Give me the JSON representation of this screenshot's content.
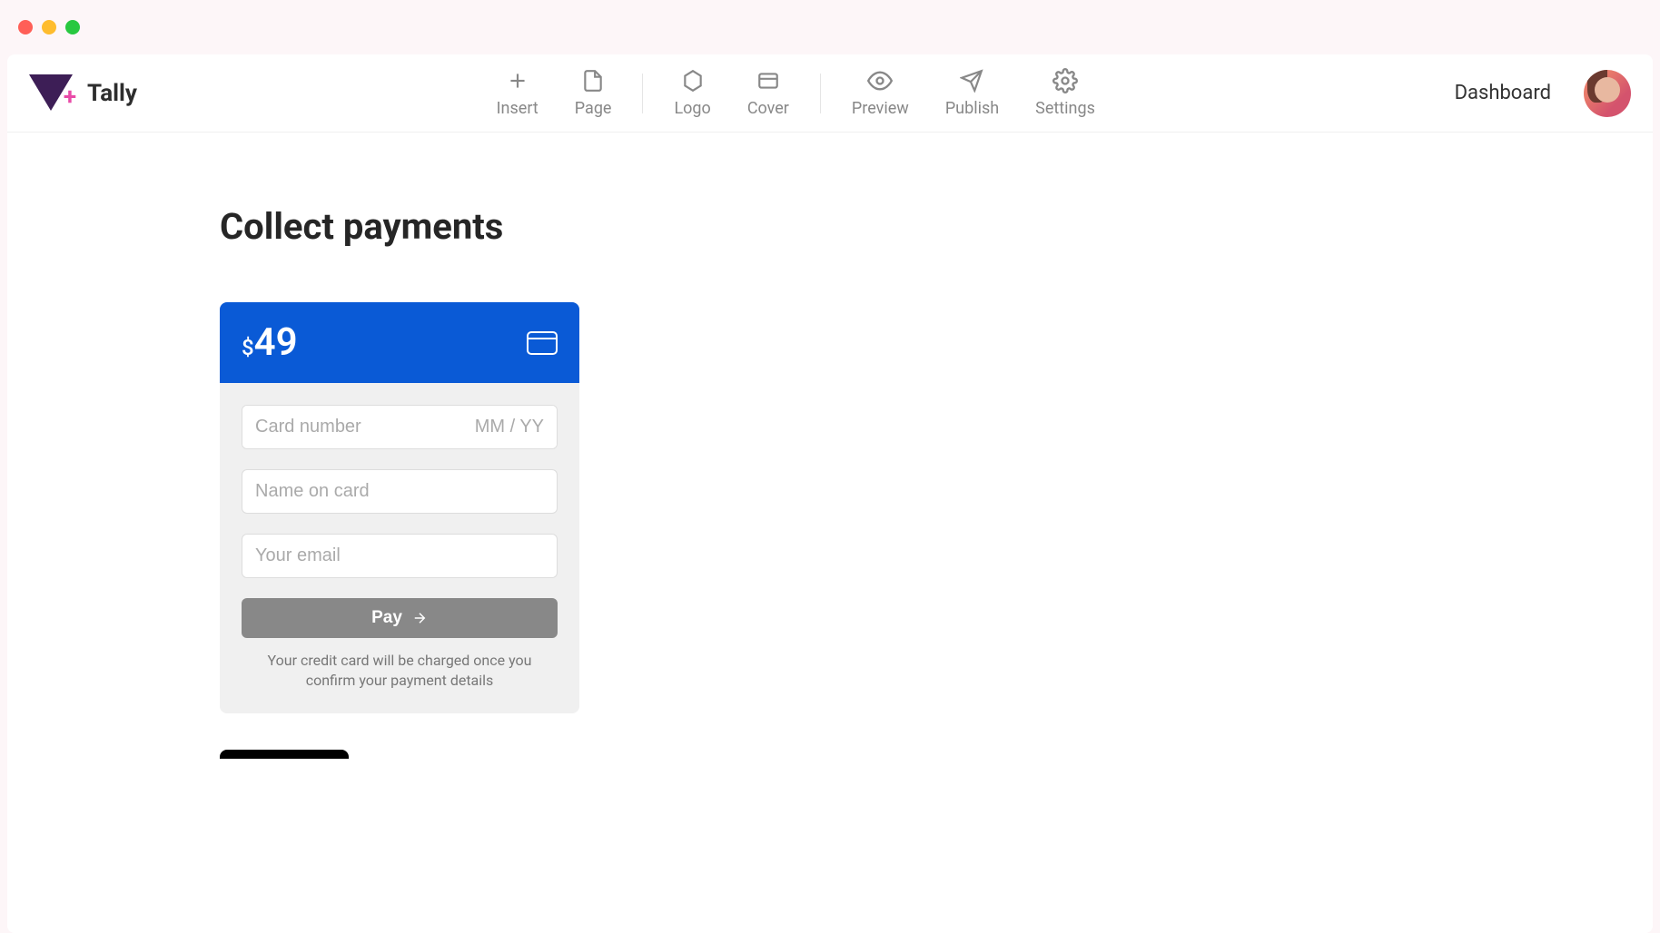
{
  "brand": {
    "name": "Tally"
  },
  "toolbar": {
    "insert": "Insert",
    "page": "Page",
    "logo": "Logo",
    "cover": "Cover",
    "preview": "Preview",
    "publish": "Publish",
    "settings": "Settings"
  },
  "header": {
    "dashboard": "Dashboard"
  },
  "content": {
    "title": "Collect payments"
  },
  "payment": {
    "currency": "$",
    "amount": "49",
    "card_number_placeholder": "Card number",
    "expiry_placeholder": "MM / YY",
    "name_placeholder": "Name on card",
    "email_placeholder": "Your email",
    "pay_button": "Pay",
    "disclaimer": "Your credit card will be charged once you confirm your payment details"
  }
}
